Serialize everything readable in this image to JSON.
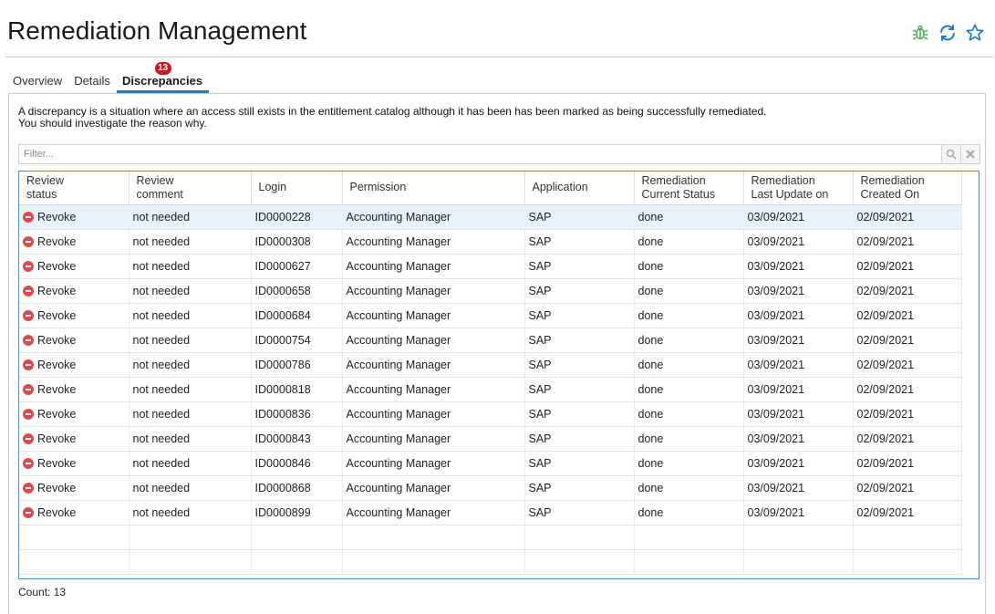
{
  "page": {
    "title": "Remediation Management"
  },
  "header_icons": [
    "bug-icon",
    "refresh-icon",
    "star-icon"
  ],
  "tabs": [
    {
      "label": "Overview",
      "active": false
    },
    {
      "label": "Details",
      "active": false
    },
    {
      "label": "Discrepancies",
      "active": true,
      "badge": "13"
    }
  ],
  "description": {
    "line1": "A discrepancy is a situation where an access still exists in the entitlement catalog although it has been has been marked as being successfully remediated.",
    "line2": "You should investigate the reason why."
  },
  "filter": {
    "placeholder": "Filter..."
  },
  "table": {
    "headers": [
      [
        "Review",
        "status"
      ],
      [
        "Review",
        "comment"
      ],
      [
        "Login"
      ],
      [
        "Permission"
      ],
      [
        "Application"
      ],
      [
        "Remediation",
        "Current Status"
      ],
      [
        "Remediation",
        "Last Update on"
      ],
      [
        "Remediation",
        "Created On"
      ]
    ],
    "rows": [
      [
        "Revoke",
        "not needed",
        "ID0000228",
        "Accounting Manager",
        "SAP",
        "done",
        "03/09/2021",
        "02/09/2021"
      ],
      [
        "Revoke",
        "not needed",
        "ID0000308",
        "Accounting Manager",
        "SAP",
        "done",
        "03/09/2021",
        "02/09/2021"
      ],
      [
        "Revoke",
        "not needed",
        "ID0000627",
        "Accounting Manager",
        "SAP",
        "done",
        "03/09/2021",
        "02/09/2021"
      ],
      [
        "Revoke",
        "not needed",
        "ID0000658",
        "Accounting Manager",
        "SAP",
        "done",
        "03/09/2021",
        "02/09/2021"
      ],
      [
        "Revoke",
        "not needed",
        "ID0000684",
        "Accounting Manager",
        "SAP",
        "done",
        "03/09/2021",
        "02/09/2021"
      ],
      [
        "Revoke",
        "not needed",
        "ID0000754",
        "Accounting Manager",
        "SAP",
        "done",
        "03/09/2021",
        "02/09/2021"
      ],
      [
        "Revoke",
        "not needed",
        "ID0000786",
        "Accounting Manager",
        "SAP",
        "done",
        "03/09/2021",
        "02/09/2021"
      ],
      [
        "Revoke",
        "not needed",
        "ID0000818",
        "Accounting Manager",
        "SAP",
        "done",
        "03/09/2021",
        "02/09/2021"
      ],
      [
        "Revoke",
        "not needed",
        "ID0000836",
        "Accounting Manager",
        "SAP",
        "done",
        "03/09/2021",
        "02/09/2021"
      ],
      [
        "Revoke",
        "not needed",
        "ID0000843",
        "Accounting Manager",
        "SAP",
        "done",
        "03/09/2021",
        "02/09/2021"
      ],
      [
        "Revoke",
        "not needed",
        "ID0000846",
        "Accounting Manager",
        "SAP",
        "done",
        "03/09/2021",
        "02/09/2021"
      ],
      [
        "Revoke",
        "not needed",
        "ID0000868",
        "Accounting Manager",
        "SAP",
        "done",
        "03/09/2021",
        "02/09/2021"
      ],
      [
        "Revoke",
        "not needed",
        "ID0000899",
        "Accounting Manager",
        "SAP",
        "done",
        "03/09/2021",
        "02/09/2021"
      ]
    ]
  },
  "count": {
    "label": "Count: 13"
  },
  "colors": {
    "accent": "#2a7ab8",
    "grid_border": "#3a95d0",
    "badge": "#d0141a",
    "revoke": "#e0484d",
    "bug_icon": "#4caf50",
    "selected_row": "#e8f2fb"
  }
}
